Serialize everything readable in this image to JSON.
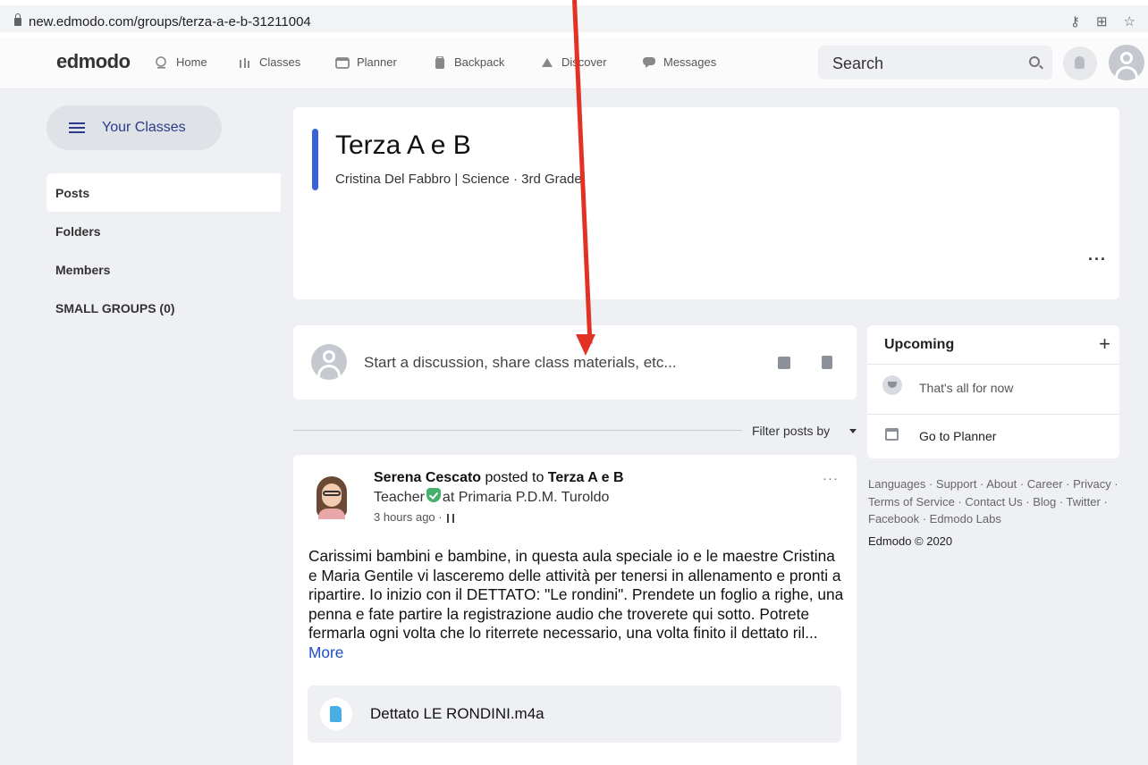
{
  "browser": {
    "url": "new.edmodo.com/groups/terza-a-e-b-31211004"
  },
  "nav": {
    "logo": "edmodo",
    "items": [
      {
        "label": "Home"
      },
      {
        "label": "Classes"
      },
      {
        "label": "Planner"
      },
      {
        "label": "Backpack"
      },
      {
        "label": "Discover"
      },
      {
        "label": "Messages"
      }
    ],
    "search_label": "Search"
  },
  "sidebar": {
    "your_classes": "Your Classes",
    "items": [
      {
        "label": "Posts",
        "active": true
      },
      {
        "label": "Folders"
      },
      {
        "label": "Members"
      },
      {
        "label": "SMALL GROUPS (0)"
      }
    ]
  },
  "class": {
    "title": "Terza A e B",
    "subtitle": "Cristina Del Fabbro | Science  · 3rd Grade",
    "more": "···",
    "accent_color": "#3b63d6"
  },
  "composer": {
    "placeholder": "Start a discussion, share class materials, etc..."
  },
  "filter": {
    "label": "Filter posts by"
  },
  "post": {
    "author": "Serena Cescato",
    "posted_to_text": "posted to",
    "group": "Terza A e B",
    "role": "Teacher",
    "school": "at Primaria P.D.M. Turoldo",
    "time": "3 hours ago ·",
    "more": "···",
    "body": "Carissimi bambini e bambine, in questa aula speciale io e le maestre Cristina e Maria Gentile vi lasceremo delle attività per tenersi in allenamento e pronti a ripartire. Io inizio con il DETTATO: \"Le rondini\". Prendete un foglio a righe, una penna e fate partire la registrazione audio che troverete qui sotto. Potrete fermarla ogni volta che lo riterrete necessario, una volta finito il dettato ril...",
    "more_link": "More",
    "attachment": "Dettato LE RONDINI.m4a"
  },
  "upcoming": {
    "title": "Upcoming",
    "plus": "+",
    "empty": "That's all for now",
    "planner": "Go to Planner"
  },
  "footer": {
    "links": "Languages · Support · About · Career · Privacy · Terms of Service · Contact Us · Blog · Twitter · Facebook · Edmodo Labs",
    "copyright": "Edmodo © 2020"
  },
  "colors": {
    "annotation_arrow": "#e23225",
    "link": "#1c4fc0",
    "verified": "#45b06c"
  }
}
